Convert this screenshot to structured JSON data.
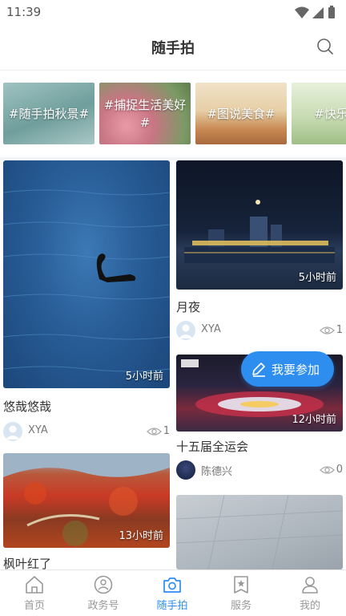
{
  "status_bar": {
    "time": "11:39"
  },
  "header": {
    "title": "随手拍",
    "search_icon": "search-icon"
  },
  "topics": [
    {
      "label": "#随手拍秋景#"
    },
    {
      "label": "#捕捉生活美好#"
    },
    {
      "label": "#图说美食#"
    },
    {
      "label": "#快乐童"
    }
  ],
  "feed": [
    {
      "title": "悠哉悠哉",
      "time": "5小时前",
      "author": "XYA",
      "views": "1"
    },
    {
      "title": "月夜",
      "time": "5小时前",
      "author": "XYA",
      "views": "1"
    },
    {
      "title": "十五届全运会",
      "time": "12小时前",
      "author": "陈德兴",
      "views": "0"
    },
    {
      "title": "枫叶红了",
      "time": "13小时前",
      "author": "",
      "views": ""
    }
  ],
  "fab": {
    "label": "我要参加",
    "icon": "edit-icon"
  },
  "tab_bar": [
    {
      "label": "首页",
      "icon": "home-icon"
    },
    {
      "label": "政务号",
      "icon": "gov-icon"
    },
    {
      "label": "随手拍",
      "icon": "camera-icon",
      "active": true
    },
    {
      "label": "服务",
      "icon": "service-icon"
    },
    {
      "label": "我的",
      "icon": "user-icon"
    }
  ],
  "colors": {
    "accent": "#2d8ef0",
    "text": "#333333",
    "muted": "#999999"
  }
}
